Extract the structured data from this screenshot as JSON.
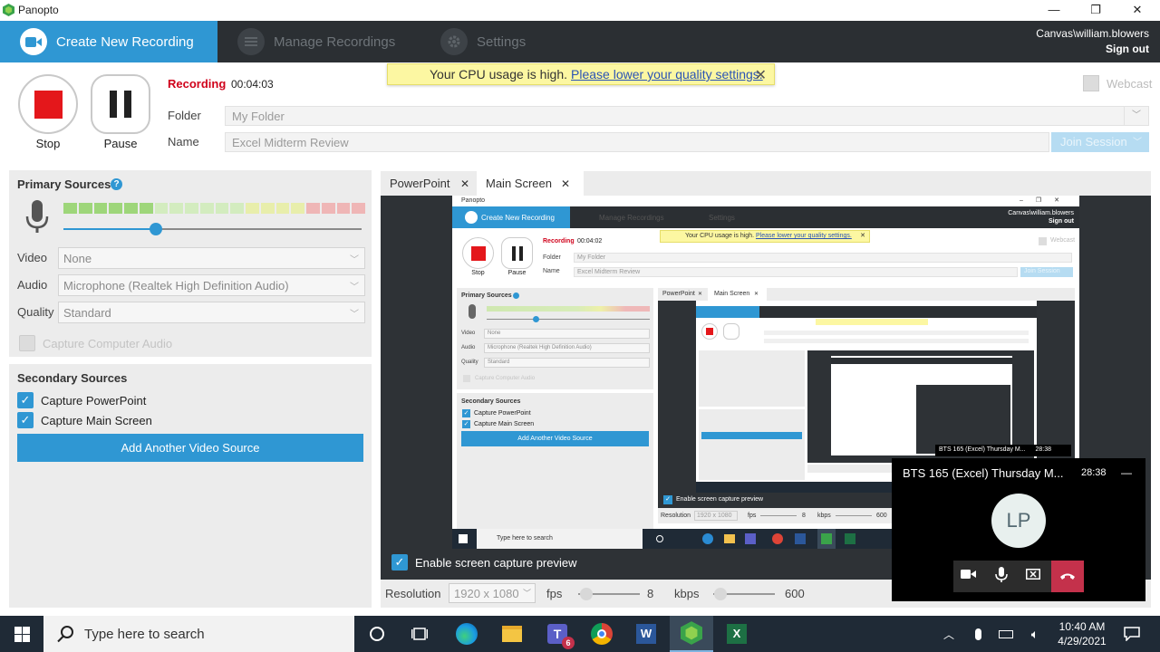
{
  "window": {
    "title": "Panopto"
  },
  "nav": {
    "create_label": "Create New Recording",
    "manage_label": "Manage Recordings",
    "settings_label": "Settings",
    "user": "Canvas\\william.blowers",
    "signout": "Sign out"
  },
  "controls": {
    "stop_label": "Stop",
    "pause_label": "Pause",
    "status": "Recording",
    "elapsed": "00:04:03",
    "folder_label": "Folder",
    "folder_value": "My Folder",
    "name_label": "Name",
    "name_value": "Excel Midterm Review",
    "join_label": "Join Session",
    "webcast_label": "Webcast"
  },
  "banner": {
    "text": "Your CPU usage is high.",
    "link": "Please lower your quality settings."
  },
  "primary": {
    "title": "Primary Sources",
    "mic_level": 0.3,
    "video_label": "Video",
    "video_value": "None",
    "audio_label": "Audio",
    "audio_value": "Microphone (Realtek High Definition Audio)",
    "quality_label": "Quality",
    "quality_value": "Standard",
    "capture_audio_label": "Capture Computer Audio"
  },
  "secondary": {
    "title": "Secondary Sources",
    "ppt_label": "Capture PowerPoint",
    "screen_label": "Capture Main Screen",
    "add_button": "Add Another Video Source"
  },
  "preview": {
    "tab1": "PowerPoint",
    "tab2": "Main Screen",
    "enable_label": "Enable screen capture preview",
    "resolution_label": "Resolution",
    "resolution_value": "1920 x 1080",
    "fps_label": "fps",
    "fps_value": "8",
    "kbps_label": "kbps",
    "kbps_value": "600"
  },
  "mini": {
    "title": "Panopto",
    "create_label": "Create New Recording",
    "manage_label": "Manage Recordings",
    "settings_label": "Settings",
    "user": "Canvas\\william.blowers",
    "signout": "Sign out",
    "status": "Recording",
    "elapsed": "00:04:02",
    "banner_text": "Your CPU usage is high.",
    "banner_link": "Please lower your quality settings.",
    "folder_label": "Folder",
    "folder_value": "My Folder",
    "name_label": "Name",
    "name_value": "Excel Midterm Review",
    "primary_title": "Primary Sources",
    "video_label": "Video",
    "video_value": "None",
    "audio_label": "Audio",
    "audio_value": "Microphone (Realtek High Definition Audio)",
    "quality_label": "Quality",
    "quality_value": "Standard",
    "capture_audio_label": "Capture Computer Audio",
    "secondary_title": "Secondary Sources",
    "ppt_label": "Capture PowerPoint",
    "screen_label": "Capture Main Screen",
    "add_button": "Add Another Video Source",
    "tab1": "PowerPoint",
    "tab2": "Main Screen",
    "enable_label": "Enable screen capture preview",
    "resolution_label": "Resolution",
    "resolution_value": "1920 x 1080",
    "fps_label": "fps",
    "fps_value": "8",
    "kbps_label": "kbps",
    "kbps_value": "600",
    "search_placeholder": "Type here to search",
    "stop_label": "Stop",
    "pause_label": "Pause",
    "webcast_label": "Webcast",
    "join_label": "Join Session",
    "call_title": "BTS 165 (Excel) Thursday M...",
    "call_time": "28:38"
  },
  "call": {
    "title": "BTS 165 (Excel) Thursday M...",
    "time": "28:38",
    "initials": "LP"
  },
  "taskbar": {
    "search_placeholder": "Type here to search",
    "teams_badge": "6",
    "time": "10:40 AM",
    "date": "4/29/2021"
  },
  "colors": {
    "accent": "#2f97d3",
    "nav_bg": "#2b2f33",
    "stop_red": "#e4171b",
    "recording_red": "#d0021b",
    "banner_bg": "#fcf7a2",
    "hangup": "#c4314b"
  }
}
